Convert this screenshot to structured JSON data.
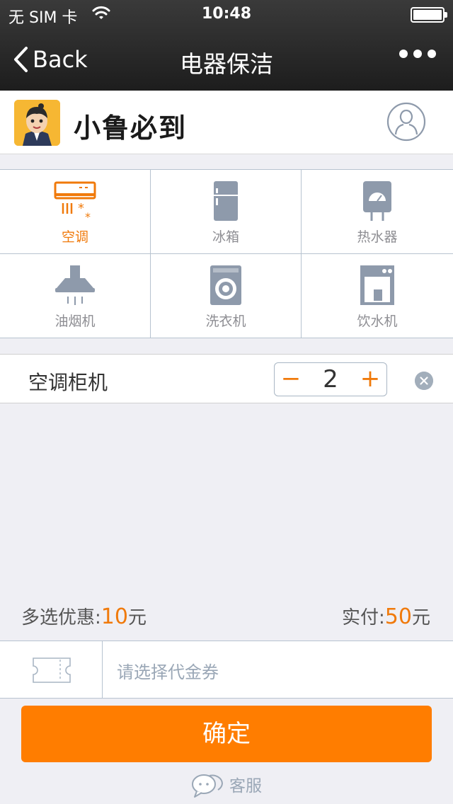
{
  "status": {
    "carrier": "无 SIM 卡",
    "time": "10:48"
  },
  "nav": {
    "back_label": "Back",
    "title": "电器保洁"
  },
  "brand": {
    "name": "小鲁必到"
  },
  "categories": [
    {
      "label": "空调",
      "icon": "air-conditioner-icon",
      "active": true
    },
    {
      "label": "冰箱",
      "icon": "refrigerator-icon",
      "active": false
    },
    {
      "label": "热水器",
      "icon": "water-heater-icon",
      "active": false
    },
    {
      "label": "油烟机",
      "icon": "range-hood-icon",
      "active": false
    },
    {
      "label": "洗衣机",
      "icon": "washing-machine-icon",
      "active": false
    },
    {
      "label": "饮水机",
      "icon": "water-dispenser-icon",
      "active": false
    }
  ],
  "item": {
    "name": "空调柜机",
    "quantity": "2",
    "minus": "−",
    "plus": "+"
  },
  "totals": {
    "discount_label": "多选优惠:",
    "discount_value": "10",
    "discount_unit": "元",
    "paid_label": "实付:",
    "paid_value": "50",
    "paid_unit": "元"
  },
  "coupon": {
    "placeholder": "请选择代金券"
  },
  "confirm_label": "确定",
  "service_label": "客服",
  "colors": {
    "accent": "#ff7d00",
    "icon_gray": "#8e9aab",
    "border": "#b7c3d0"
  }
}
